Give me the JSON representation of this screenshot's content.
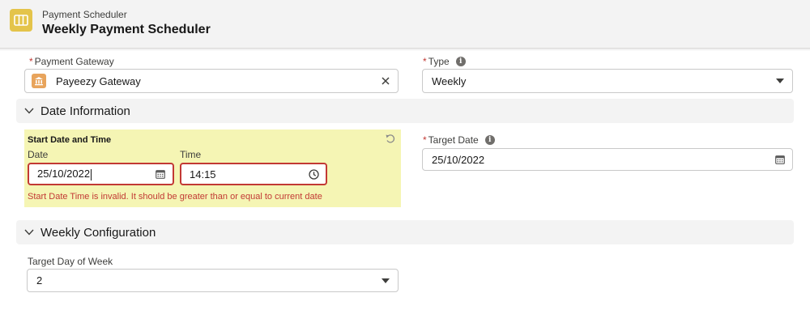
{
  "header": {
    "object_label": "Payment Scheduler",
    "record_title": "Weekly Payment Scheduler",
    "icon": "scheduler-icon"
  },
  "payment_gateway": {
    "label": "Payment Gateway",
    "required": true,
    "value": "Payeezy Gateway",
    "icon": "bank-icon"
  },
  "type": {
    "label": "Type",
    "required": true,
    "value": "Weekly"
  },
  "date_section": {
    "title": "Date Information"
  },
  "start": {
    "title": "Start Date and Time",
    "date_label": "Date",
    "date_value": "25/10/2022",
    "time_label": "Time",
    "time_value": "14:15",
    "error": "Start Date Time is invalid. It should be greater than or equal to current date"
  },
  "target_date": {
    "label": "Target Date",
    "required": true,
    "value": "25/10/2022"
  },
  "weekly_section": {
    "title": "Weekly Configuration"
  },
  "target_day": {
    "label": "Target Day of Week",
    "value": "2"
  },
  "colors": {
    "error": "#c23934",
    "highlight": "#f5f5b4",
    "app_icon": "#e4c44a",
    "gateway_icon": "#e8a45c"
  }
}
